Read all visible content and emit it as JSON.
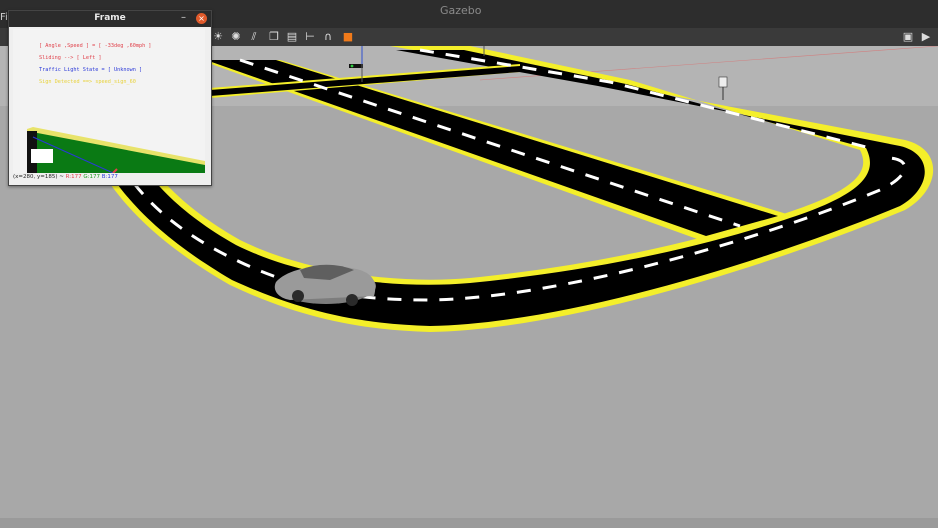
{
  "window": {
    "title": "Gazebo",
    "menu_file": "File"
  },
  "toolbar": {
    "icons": [
      "sun-icon",
      "spot-light-icon",
      "directional-light-icon",
      "copy-icon",
      "paste-icon",
      "align-icon",
      "snap-icon",
      "record-icon"
    ],
    "right_icons": [
      "screenshot-icon",
      "video-record-icon"
    ]
  },
  "frame_window": {
    "title": "Frame",
    "minimize_label": "–",
    "close_label": "×",
    "overlay": {
      "angle_speed": "[ Angle ,Speed ] = [ -33deg ,60mph ]",
      "sliding": "Sliding --> [ Left ]",
      "traffic_light": "Traffic Light State = [ Unknown ]",
      "sign_detected": "Sign Detected ==> speed_sign_60"
    },
    "status": {
      "coords": "(x=280, y=185) ~",
      "r": "R:177",
      "g": "G:177",
      "b": "B:177"
    }
  },
  "colors": {
    "ground": "#a9a9a9",
    "road": "#000000",
    "road_edge": "#f4ef2a",
    "lane_marking": "#ffffff",
    "overlay_red": "#e0404a",
    "overlay_blue": "#2a38d8",
    "overlay_yellow": "#e8d23a",
    "grass": "#0a7a14"
  }
}
